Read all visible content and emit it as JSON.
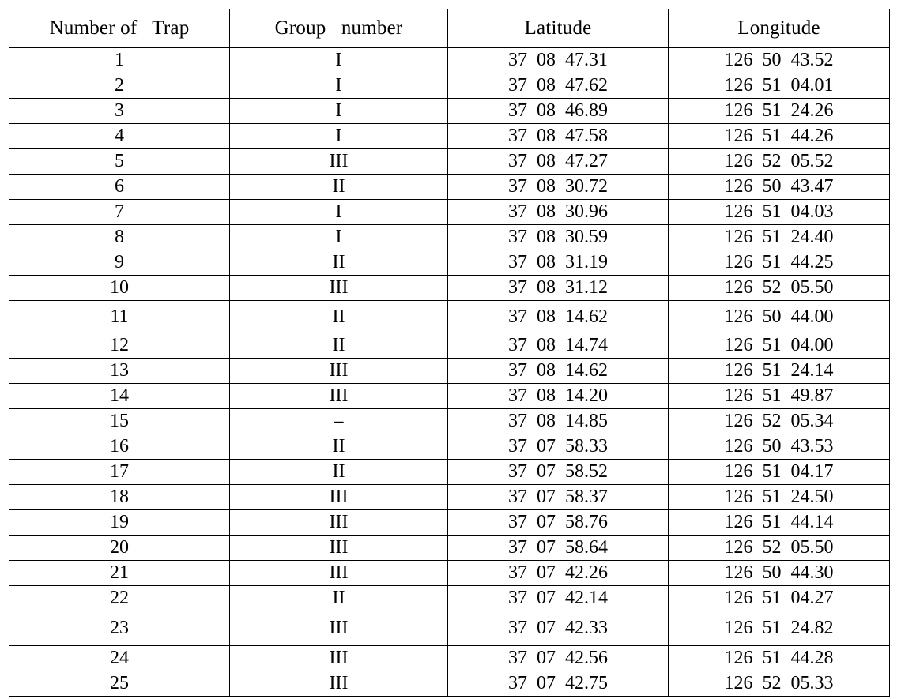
{
  "table": {
    "columns": [
      {
        "key": "trap_number",
        "label": "Number of   Trap"
      },
      {
        "key": "group_number",
        "label": "Group   number"
      },
      {
        "key": "latitude",
        "label": "Latitude"
      },
      {
        "key": "longitude",
        "label": "Longitude"
      }
    ],
    "rows": [
      {
        "trap_number": "1",
        "group_number": "I",
        "latitude": "37  08  47.31",
        "longitude": "126  50  43.52"
      },
      {
        "trap_number": "2",
        "group_number": "I",
        "latitude": "37  08  47.62",
        "longitude": "126  51  04.01"
      },
      {
        "trap_number": "3",
        "group_number": "I",
        "latitude": "37  08  46.89",
        "longitude": "126  51  24.26"
      },
      {
        "trap_number": "4",
        "group_number": "I",
        "latitude": "37  08  47.58",
        "longitude": "126  51  44.26"
      },
      {
        "trap_number": "5",
        "group_number": "III",
        "latitude": "37  08  47.27",
        "longitude": "126  52  05.52"
      },
      {
        "trap_number": "6",
        "group_number": "II",
        "latitude": "37  08  30.72",
        "longitude": "126  50  43.47"
      },
      {
        "trap_number": "7",
        "group_number": "I",
        "latitude": "37  08  30.96",
        "longitude": "126  51  04.03"
      },
      {
        "trap_number": "8",
        "group_number": "I",
        "latitude": "37  08  30.59",
        "longitude": "126  51  24.40"
      },
      {
        "trap_number": "9",
        "group_number": "II",
        "latitude": "37  08  31.19",
        "longitude": "126  51  44.25"
      },
      {
        "trap_number": "10",
        "group_number": "III",
        "latitude": "37  08  31.12",
        "longitude": "126  52  05.50"
      },
      {
        "trap_number": "11",
        "group_number": "II",
        "latitude": "37  08  14.62",
        "longitude": "126  50  44.00"
      },
      {
        "trap_number": "12",
        "group_number": "II",
        "latitude": "37  08  14.74",
        "longitude": "126  51  04.00"
      },
      {
        "trap_number": "13",
        "group_number": "III",
        "latitude": "37  08  14.62",
        "longitude": "126  51  24.14"
      },
      {
        "trap_number": "14",
        "group_number": "III",
        "latitude": "37  08  14.20",
        "longitude": "126  51  49.87"
      },
      {
        "trap_number": "15",
        "group_number": "–",
        "latitude": "37  08  14.85",
        "longitude": "126  52  05.34"
      },
      {
        "trap_number": "16",
        "group_number": "II",
        "latitude": "37  07  58.33",
        "longitude": "126  50  43.53"
      },
      {
        "trap_number": "17",
        "group_number": "II",
        "latitude": "37  07  58.52",
        "longitude": "126  51  04.17"
      },
      {
        "trap_number": "18",
        "group_number": "III",
        "latitude": "37  07  58.37",
        "longitude": "126  51  24.50"
      },
      {
        "trap_number": "19",
        "group_number": "III",
        "latitude": "37  07  58.76",
        "longitude": "126  51  44.14"
      },
      {
        "trap_number": "20",
        "group_number": "III",
        "latitude": "37  07  58.64",
        "longitude": "126  52  05.50"
      },
      {
        "trap_number": "21",
        "group_number": "III",
        "latitude": "37  07  42.26",
        "longitude": "126  50  44.30"
      },
      {
        "trap_number": "22",
        "group_number": "II",
        "latitude": "37  07  42.14",
        "longitude": "126  51  04.27"
      },
      {
        "trap_number": "23",
        "group_number": "III",
        "latitude": "37  07  42.33",
        "longitude": "126  51  24.82"
      },
      {
        "trap_number": "24",
        "group_number": "III",
        "latitude": "37  07  42.56",
        "longitude": "126  51  44.28"
      },
      {
        "trap_number": "25",
        "group_number": "III",
        "latitude": "37  07  42.75",
        "longitude": "126  52  05.33"
      }
    ]
  },
  "colors": {
    "border": "#000000",
    "text": "#000000",
    "background": "#ffffff"
  }
}
